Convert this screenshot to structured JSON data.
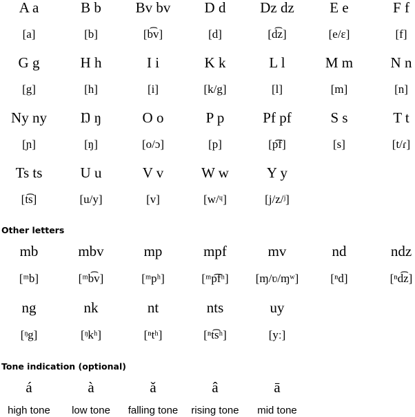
{
  "alphabet": [
    {
      "letter": "A a",
      "ipa": "[a]"
    },
    {
      "letter": "B b",
      "ipa": "[b]"
    },
    {
      "letter": "Bv bv",
      "ipa": "[b͡v]"
    },
    {
      "letter": "D d",
      "ipa": "[d]"
    },
    {
      "letter": "Dz dz",
      "ipa": "[d͡z]"
    },
    {
      "letter": "E e",
      "ipa": "[e/ɛ]"
    },
    {
      "letter": "F f",
      "ipa": "[f]"
    },
    {
      "letter": "G g",
      "ipa": "[g]"
    },
    {
      "letter": "H h",
      "ipa": "[h]"
    },
    {
      "letter": "I i",
      "ipa": "[i]"
    },
    {
      "letter": "K k",
      "ipa": "[k/g]"
    },
    {
      "letter": "L l",
      "ipa": "[l]"
    },
    {
      "letter": "M m",
      "ipa": "[m]"
    },
    {
      "letter": "N n",
      "ipa": "[n]"
    },
    {
      "letter": "Ny ny",
      "ipa": "[ɲ]"
    },
    {
      "letter": "Ŋ ŋ",
      "ipa": "[ŋ]"
    },
    {
      "letter": "O o",
      "ipa": "[o/ɔ]"
    },
    {
      "letter": "P p",
      "ipa": "[p]"
    },
    {
      "letter": "Pf pf",
      "ipa": "[p͡f]"
    },
    {
      "letter": "S s",
      "ipa": "[s]"
    },
    {
      "letter": "T t",
      "ipa": "[t/ɾ]"
    },
    {
      "letter": "Ts ts",
      "ipa": "[t͡s]"
    },
    {
      "letter": "U u",
      "ipa": "[u/y]"
    },
    {
      "letter": "V v",
      "ipa": "[v]"
    },
    {
      "letter": "W w",
      "ipa": "[w/ᶣ]"
    },
    {
      "letter": "Y y",
      "ipa": "[j/z/ʲ]"
    }
  ],
  "other_letters": {
    "heading": "Other letters",
    "items": [
      {
        "letter": "mb",
        "ipa": "[ᵐb]"
      },
      {
        "letter": "mbv",
        "ipa": "[ᵐb͡v]"
      },
      {
        "letter": "mp",
        "ipa": "[ᵐpʰ]"
      },
      {
        "letter": "mpf",
        "ipa": "[ᵐp͡fʰ]"
      },
      {
        "letter": "mv",
        "ipa": "[ɱ/ʋ/ɱʷ]"
      },
      {
        "letter": "nd",
        "ipa": "[ⁿd]"
      },
      {
        "letter": "ndz",
        "ipa": "[ⁿd͡z]"
      },
      {
        "letter": "ng",
        "ipa": "[ᵑg]"
      },
      {
        "letter": "nk",
        "ipa": "[ᵑkʰ]"
      },
      {
        "letter": "nt",
        "ipa": "[ⁿtʰ]"
      },
      {
        "letter": "nts",
        "ipa": "[ⁿt͡sʰ]"
      },
      {
        "letter": "uy",
        "ipa": "[yː]"
      }
    ]
  },
  "tones": {
    "heading": "Tone indication (optional)",
    "items": [
      {
        "mark": "á",
        "name": "high tone"
      },
      {
        "mark": "à",
        "name": "low tone"
      },
      {
        "mark": "ǎ",
        "name": "falling tone"
      },
      {
        "mark": "â",
        "name": "rising tone"
      },
      {
        "mark": "ā",
        "name": "mid tone"
      }
    ]
  }
}
